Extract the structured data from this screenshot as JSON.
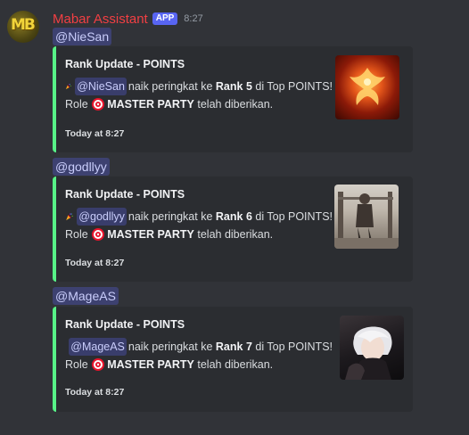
{
  "message": {
    "username": "Mabar Assistant",
    "badge": "APP",
    "time": "8:27",
    "avatar_text": "MB"
  },
  "posts": [
    {
      "mention": "@NieSan",
      "embed": {
        "title": "Rank Update - POINTS",
        "user": "@NieSan",
        "text_before": "naik peringkat ke",
        "rank": "Rank 5",
        "text_after": "di Top POINTS!",
        "role_prefix": "Role",
        "role_name": "MASTER PARTY",
        "role_suffix": "telah diberikan.",
        "footer": "Today at 8:27",
        "thumbnail": "phoenix-image"
      }
    },
    {
      "mention": "@godllyy",
      "embed": {
        "title": "Rank Update - POINTS",
        "user": "@godllyy",
        "text_before": "naik peringkat ke",
        "rank": "Rank 6",
        "text_after": "di Top POINTS!",
        "role_prefix": "Role",
        "role_name": "MASTER PARTY",
        "role_suffix": "telah diberikan.",
        "footer": "Today at 8:27",
        "thumbnail": "gym-photo"
      }
    },
    {
      "mention": "@MageAS",
      "embed": {
        "title": "Rank Update - POINTS",
        "user": "@MageAS",
        "text_before": "naik peringkat ke",
        "rank": "Rank 7",
        "text_after": "di Top POINTS!",
        "role_prefix": "Role",
        "role_name": "MASTER PARTY",
        "role_suffix": "telah diberikan.",
        "footer": "Today at 8:27",
        "thumbnail": "anime-character-image"
      }
    }
  ],
  "colors": {
    "background": "#313338",
    "embed_bg": "#2b2d31",
    "embed_border": "#57f287",
    "username": "#f23f43",
    "badge": "#5865f2"
  }
}
